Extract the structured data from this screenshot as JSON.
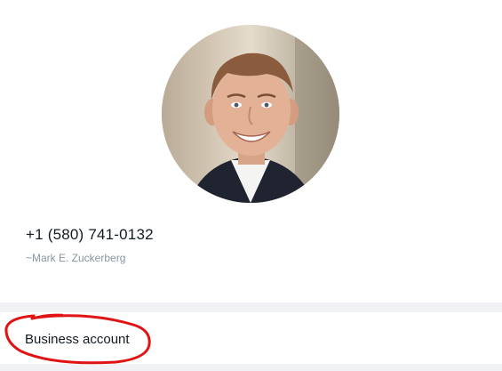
{
  "profile": {
    "phone": "+1 (580) 741-0132",
    "pushname": "~Mark E. Zuckerberg",
    "avatar_icon": "profile-photo"
  },
  "business": {
    "label": "Business account"
  },
  "annotation": {
    "color": "#e01414",
    "shape": "hand-drawn-circle"
  }
}
